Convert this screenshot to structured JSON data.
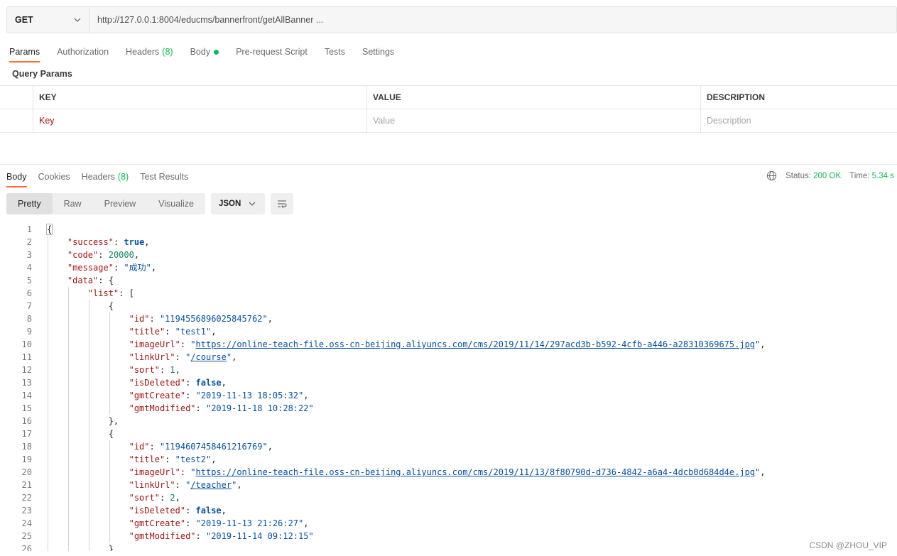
{
  "request": {
    "method": "GET",
    "url": "http://127.0.0.1:8004/educms/bannerfront/getAllBanner ..."
  },
  "request_tabs": [
    {
      "label": "Params",
      "active": true
    },
    {
      "label": "Authorization"
    },
    {
      "label": "Headers",
      "count": "(8)"
    },
    {
      "label": "Body",
      "dot": true
    },
    {
      "label": "Pre-request Script"
    },
    {
      "label": "Tests"
    },
    {
      "label": "Settings"
    }
  ],
  "query_params": {
    "title": "Query Params",
    "headers": [
      "KEY",
      "VALUE",
      "DESCRIPTION"
    ],
    "placeholders": [
      "Key",
      "Value",
      "Description"
    ]
  },
  "response_tabs": [
    {
      "label": "Body",
      "active": true
    },
    {
      "label": "Cookies"
    },
    {
      "label": "Headers",
      "count": "(8)"
    },
    {
      "label": "Test Results"
    }
  ],
  "status": {
    "status_label": "Status:",
    "status_value": "200 OK",
    "time_label": "Time:",
    "time_value": "5.34 s"
  },
  "view_modes": [
    "Pretty",
    "Raw",
    "Preview",
    "Visualize"
  ],
  "format": "JSON",
  "response_body": {
    "success": "true",
    "code": "20000",
    "message": "成功",
    "items": [
      {
        "id": "1194556896025845762",
        "title": "test1",
        "imageUrl": "https://online-teach-file.oss-cn-beijing.aliyuncs.com/cms/2019/11/14/297acd3b-b592-4cfb-a446-a28310369675.jpg",
        "linkUrl": "/course",
        "sort": "1",
        "isDeleted": "false",
        "gmtCreate": "2019-11-13 18:05:32",
        "gmtModified": "2019-11-18 10:28:22"
      },
      {
        "id": "1194607458461216769",
        "title": "test2",
        "imageUrl": "https://online-teach-file.oss-cn-beijing.aliyuncs.com/cms/2019/11/13/8f80790d-d736-4842-a6a4-4dcb0d684d4e.jpg",
        "linkUrl": "/teacher",
        "sort": "2",
        "isDeleted": "false",
        "gmtCreate": "2019-11-13 21:26:27",
        "gmtModified": "2019-11-14 09:12:15"
      }
    ]
  },
  "line_numbers": [
    "1",
    "2",
    "3",
    "4",
    "5",
    "6",
    "7",
    "8",
    "9",
    "10",
    "11",
    "12",
    "13",
    "14",
    "15",
    "16",
    "17",
    "18",
    "19",
    "20",
    "21",
    "22",
    "23",
    "24",
    "25",
    "26"
  ],
  "watermark": "CSDN @ZHOU_VIP"
}
